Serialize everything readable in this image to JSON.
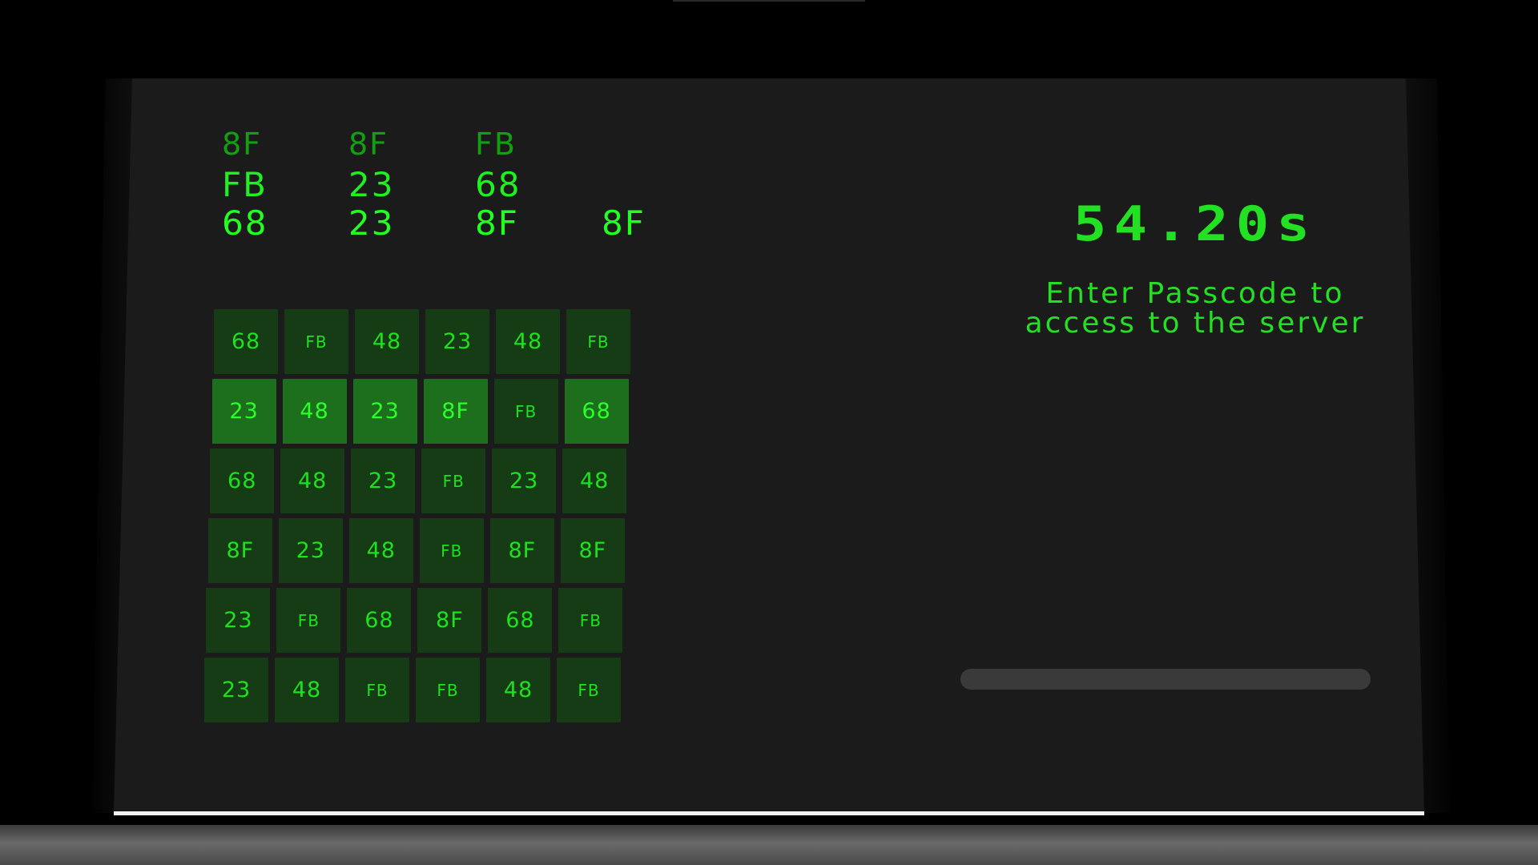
{
  "timer": "54.20s",
  "prompt": {
    "line1": "Enter Passcode to",
    "line2": "access to the server"
  },
  "sequence": {
    "rows": [
      [
        "8F",
        "8F",
        "FB"
      ],
      [
        "FB",
        "23",
        "68"
      ],
      [
        "68",
        "23",
        "8F",
        "8F"
      ]
    ]
  },
  "grid": {
    "rows": [
      [
        "68",
        "FB",
        "48",
        "23",
        "48",
        "FB"
      ],
      [
        "23",
        "48",
        "23",
        "8F",
        "FB",
        "68"
      ],
      [
        "68",
        "48",
        "23",
        "FB",
        "23",
        "48"
      ],
      [
        "8F",
        "23",
        "48",
        "FB",
        "8F",
        "8F"
      ],
      [
        "23",
        "FB",
        "68",
        "8F",
        "68",
        "FB"
      ],
      [
        "23",
        "48",
        "FB",
        "FB",
        "48",
        "FB"
      ]
    ],
    "highlighted_row": 1,
    "highlighted_cols": [
      0,
      1,
      2,
      3,
      5
    ]
  },
  "progress": 0,
  "colors": {
    "text_green": "#22e022",
    "dim_green": "#12a012",
    "tile": "#153c15",
    "tile_highlight": "#1d6e1d",
    "screen": "#1b1b1b",
    "track": "#3a3a3a"
  }
}
